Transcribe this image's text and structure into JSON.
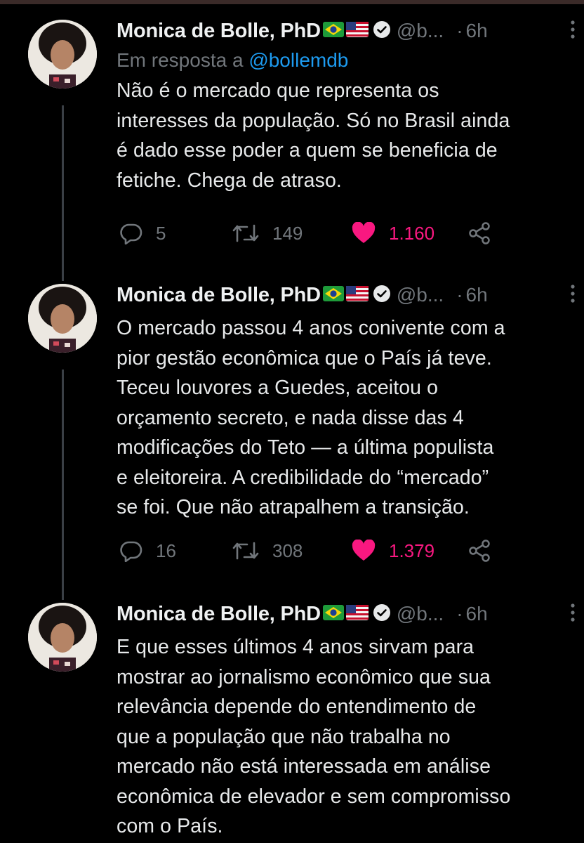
{
  "tweets": [
    {
      "author": "Monica de Bolle, PhD",
      "handle": "@b...",
      "separator": "·",
      "time": "6h",
      "reply_prefix": "Em resposta a ",
      "reply_to": "@bollemdb",
      "text": "Não é o mercado que representa os\ninteresses da população. Só no Brasil ainda\né dado esse poder a quem se beneficia de\nfetiche. Chega de atraso.",
      "replies": "5",
      "retweets": "149",
      "likes": "1.160"
    },
    {
      "author": "Monica de Bolle, PhD",
      "handle": "@b...",
      "separator": "·",
      "time": "6h",
      "text": "O mercado passou 4 anos conivente com a\npior gestão econômica que o País já teve.\nTeceu louvores a Guedes, aceitou o\norçamento secreto, e nada disse das 4\nmodificações do Teto — a última populista\ne eleitoreira. A credibilidade do “mercado”\nse foi. Que não atrapalhem a transição.",
      "replies": "16",
      "retweets": "308",
      "likes": "1.379"
    },
    {
      "author": "Monica de Bolle, PhD",
      "handle": "@b...",
      "separator": "·",
      "time": "6h",
      "text": "E que esses últimos 4 anos sirvam para\nmostrar ao jornalismo econômico que sua\nrelevância depende do entendimento de\nque a população que não trabalha no\nmercado não está interessada em análise\neconômica de elevador e sem compromisso\ncom o País."
    }
  ],
  "icons": {
    "flags": [
      "brazil-flag-icon",
      "us-flag-icon"
    ],
    "verified": "verified-badge-icon",
    "actions": [
      "reply-icon",
      "retweet-icon",
      "heart-icon",
      "share-icon"
    ]
  },
  "colors": {
    "background": "#000000",
    "text": "#e7e9ea",
    "muted": "#71767b",
    "link": "#1d9bf0",
    "like": "#f91880",
    "thread_line": "#3a3f45"
  }
}
